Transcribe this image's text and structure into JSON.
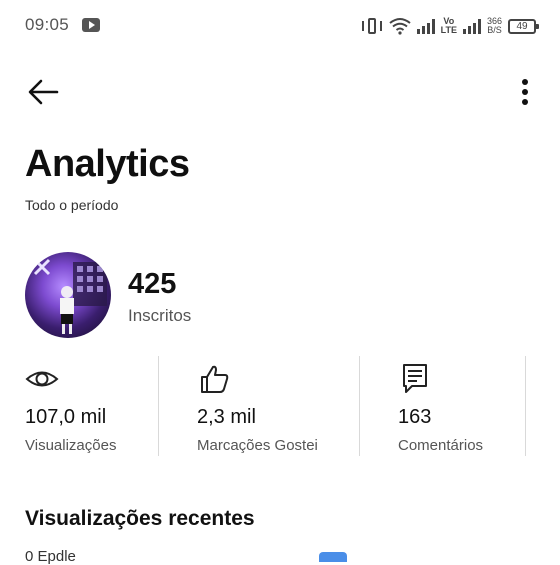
{
  "status": {
    "time": "09:05",
    "network_label": "Vo\nLTE",
    "speed": "366\nB/S",
    "battery": "49"
  },
  "header": {
    "title": "Analytics",
    "subtitle": "Todo o período"
  },
  "channel": {
    "subscribers": "425",
    "subscribers_label": "Inscritos"
  },
  "stats": [
    {
      "icon": "eye-icon",
      "value": "107,0 mil",
      "label": "Visualizações"
    },
    {
      "icon": "thumbs-up-icon",
      "value": "2,3 mil",
      "label": "Marcações Gostei"
    },
    {
      "icon": "comment-icon",
      "value": "163",
      "label": "Comentários"
    }
  ],
  "recent": {
    "title": "Visualizações recentes",
    "first_item": "0 Epdle"
  },
  "colors": {
    "accent": "#4a8ee8",
    "text_primary": "#111111",
    "text_secondary": "#555555"
  }
}
